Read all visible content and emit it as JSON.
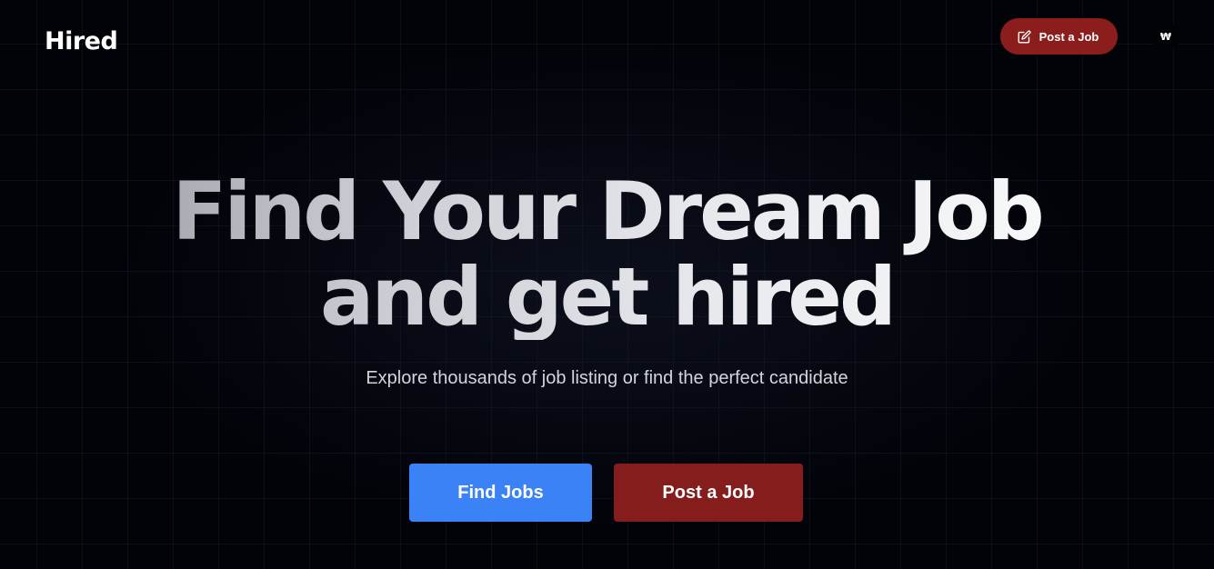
{
  "header": {
    "logo": "Hired",
    "post_job_label": "Post a Job",
    "post_job_icon": "pencil-square-icon",
    "avatar_text": "₩"
  },
  "hero": {
    "title_line1": "Find Your Dream Job",
    "title_line2": "and get hired",
    "subtitle": "Explore thousands of job listing or find the perfect candidate"
  },
  "cta": {
    "find_jobs_label": "Find Jobs",
    "post_job_label": "Post a Job"
  },
  "colors": {
    "background": "#020309",
    "accent_red": "#861d1d",
    "accent_blue": "#3b82f6"
  }
}
